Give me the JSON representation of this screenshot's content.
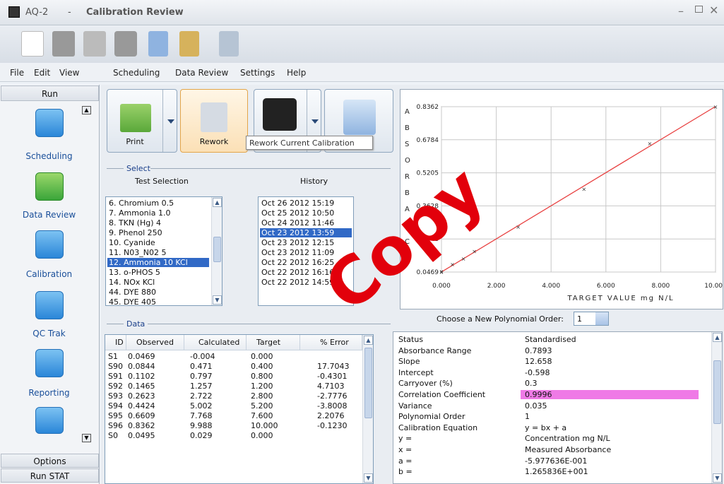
{
  "window": {
    "app": "AQ-2",
    "sep": "-",
    "page": "Calibration Review",
    "min": "–",
    "close": "✕"
  },
  "menu": [
    "File",
    "Edit",
    "View",
    "Scheduling",
    "Data Review",
    "Settings",
    "Help"
  ],
  "nav": {
    "header": "Run",
    "items": [
      {
        "label": "Scheduling",
        "icon": "scheduling-icon"
      },
      {
        "label": "Data Review",
        "icon": "data-review-icon"
      },
      {
        "label": "Calibration",
        "icon": "calibration-icon"
      },
      {
        "label": "QC Trak",
        "icon": "qc-trak-icon"
      },
      {
        "label": "Reporting",
        "icon": "reporting-icon"
      }
    ],
    "options": "Options",
    "run_stat": "Run STAT"
  },
  "actions": {
    "print": "Print",
    "rework": "Rework",
    "tooltip": "Rework Current Calibration"
  },
  "select": {
    "group": "Select",
    "test_header": "Test Selection",
    "history_header": "History",
    "tests": [
      "6. Chromium 0.5",
      "7. Ammonia 1.0",
      "8. TKN (Hg) 4",
      "9. Phenol 250",
      "10. Cyanide",
      "11. N03_N02 5",
      "12. Ammonia 10 KCl",
      "13. o-PHOS 5",
      "14. NOx KCl",
      "44. DYE 880",
      "45. DYE 405"
    ],
    "selected_test": 6,
    "history": [
      "Oct 26 2012 15:19",
      "Oct 25 2012 10:50",
      "Oct 24 2012 11:46",
      "Oct 23 2012 13:59",
      "Oct 23 2012 12:15",
      "Oct 23 2012 11:09",
      "Oct 22 2012 16:25",
      "Oct 22 2012 16:16",
      "Oct 22 2012 14:59"
    ],
    "selected_history": 3
  },
  "data": {
    "group": "Data",
    "columns": [
      "ID",
      "Observed",
      "Calculated",
      "Target",
      "% Error"
    ],
    "rows": [
      [
        "S1",
        "0.0469",
        "-0.004",
        "0.000",
        ""
      ],
      [
        "S90",
        "0.0844",
        "0.471",
        "0.400",
        "17.7043"
      ],
      [
        "S91",
        "0.1102",
        "0.797",
        "0.800",
        "-0.4301"
      ],
      [
        "S92",
        "0.1465",
        "1.257",
        "1.200",
        "4.7103"
      ],
      [
        "S93",
        "0.2623",
        "2.722",
        "2.800",
        "-2.7776"
      ],
      [
        "S94",
        "0.4424",
        "5.002",
        "5.200",
        "-3.8008"
      ],
      [
        "S95",
        "0.6609",
        "7.768",
        "7.600",
        "2.2076"
      ],
      [
        "S96",
        "0.8362",
        "9.988",
        "10.000",
        "-0.1230"
      ],
      [
        "S0",
        "0.0495",
        "0.029",
        "0.000",
        ""
      ]
    ]
  },
  "poly": {
    "label": "Choose a New Polynomial Order:",
    "value": "1"
  },
  "info": [
    [
      "Status",
      "Standardised"
    ],
    [
      "Absorbance Range",
      "0.7893"
    ],
    [
      "Slope",
      "12.658"
    ],
    [
      "Intercept",
      "-0.598"
    ],
    [
      "Carryover (%)",
      "0.3"
    ],
    [
      "Correlation Coefficient",
      "0.9996"
    ],
    [
      "Variance",
      "0.035"
    ],
    [
      "Polynomial Order",
      "1"
    ],
    [
      "Calibration Equation",
      "y = bx + a"
    ],
    [
      "y =",
      "Concentration mg N/L"
    ],
    [
      "x =",
      "Measured Absorbance"
    ],
    [
      "a =",
      "-5.977636E-001"
    ],
    [
      "b =",
      "1.265836E+001"
    ]
  ],
  "watermark": "Copy",
  "chart_data": {
    "type": "scatter",
    "xlabel": "TARGET VALUE mg N/L",
    "ylabel": "ABSORBANCE",
    "xticks": [
      "0.000",
      "2.000",
      "4.000",
      "6.000",
      "8.000",
      "10.000"
    ],
    "yticks": [
      "0.0469",
      "0.2048",
      "0.3628",
      "0.5205",
      "0.6784",
      "0.8362"
    ],
    "xlim": [
      0,
      10
    ],
    "ylim": [
      0.0469,
      0.8362
    ],
    "points": [
      [
        0,
        0.0469
      ],
      [
        0.4,
        0.0844
      ],
      [
        0.8,
        0.1102
      ],
      [
        1.2,
        0.1465
      ],
      [
        2.8,
        0.2623
      ],
      [
        5.2,
        0.4424
      ],
      [
        7.6,
        0.6609
      ],
      [
        10,
        0.8362
      ],
      [
        0,
        0.0495
      ]
    ],
    "fit": {
      "slope": 12.658,
      "intercept": -0.598
    },
    "grid": true
  }
}
